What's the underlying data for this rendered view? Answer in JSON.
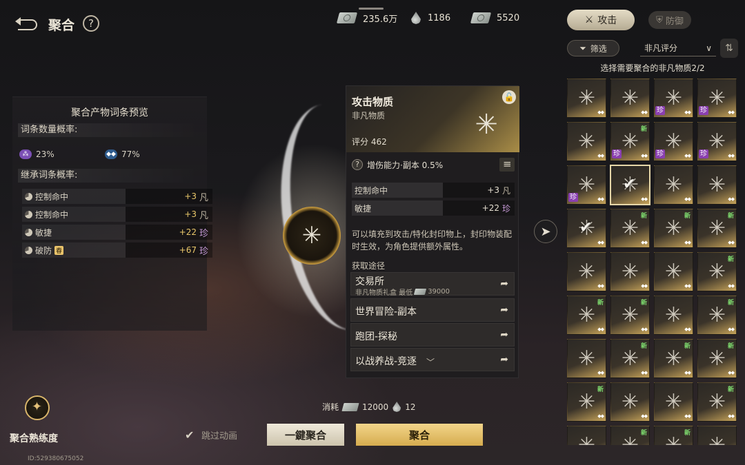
{
  "header": {
    "title": "聚合",
    "help_glyph": "?",
    "currencies": [
      {
        "icon": "cash-stack-icon",
        "value": "235.6万"
      },
      {
        "icon": "droplet-icon",
        "value": "1186"
      },
      {
        "icon": "cash-bundle-icon",
        "value": "5520"
      }
    ]
  },
  "preview": {
    "title": "聚合产物词条预览",
    "count_prob_label": "词条数量概率:",
    "count_probs": [
      {
        "value": "23%",
        "color": "#7b4fb5",
        "glyph": "⁂"
      },
      {
        "value": "77%",
        "color": "#2f5c8e",
        "glyph": "◆◆"
      }
    ],
    "inherit_label": "继承词条概率:",
    "affixes": [
      {
        "name": "控制命中",
        "value": "+3",
        "rank": "凡",
        "rank_type": "fan"
      },
      {
        "name": "控制命中",
        "value": "+3",
        "rank": "凡",
        "rank_type": "fan"
      },
      {
        "name": "敏捷",
        "value": "+22",
        "rank": "珍",
        "rank_type": "zhen"
      },
      {
        "name": "破防",
        "tag": "春",
        "value": "+67",
        "rank": "珍",
        "rank_type": "zhen"
      }
    ]
  },
  "card": {
    "name": "攻击物质",
    "type": "非凡物质",
    "score": "评分  462",
    "skill": "增伤能力·副本  0.5%",
    "stats": [
      {
        "name": "控制命中",
        "value": "+3",
        "rank": "凡"
      },
      {
        "name": "敏捷",
        "value": "+22",
        "rank": "珍"
      }
    ],
    "desc": "可以填充到攻击/特化封印物上，封印物装配时生效，为角色提供额外属性。",
    "source_label": "获取途径",
    "routes": [
      {
        "name": "交易所",
        "sub_prefix": "非凡物质礼盒 最低",
        "sub_value": "39000"
      },
      {
        "name": "世界冒险-副本"
      },
      {
        "name": "跑团-探秘"
      },
      {
        "name": "以战养战-竞逐"
      }
    ]
  },
  "right": {
    "tab_attack": "攻击",
    "tab_defense": "防御",
    "filter": "筛选",
    "sort": "非凡评分",
    "hint": "选择需要聚合的非凡物质2/2",
    "grid": [
      {
        "zhen": false,
        "new": false
      },
      {
        "zhen": false,
        "new": false
      },
      {
        "zhen": true,
        "new": false
      },
      {
        "zhen": true,
        "new": false
      },
      {
        "zhen": false,
        "new": false
      },
      {
        "zhen": true,
        "new": true
      },
      {
        "zhen": true,
        "new": false
      },
      {
        "zhen": true,
        "new": false
      },
      {
        "zhen": true,
        "new": false
      },
      {
        "zhen": false,
        "new": false,
        "selected": true,
        "check": true
      },
      {
        "zhen": false,
        "new": false
      },
      {
        "zhen": false,
        "new": false
      },
      {
        "zhen": false,
        "new": false,
        "check": true
      },
      {
        "zhen": false,
        "new": true
      },
      {
        "zhen": false,
        "new": true
      },
      {
        "zhen": false,
        "new": true
      },
      {
        "zhen": false,
        "new": false
      },
      {
        "zhen": false,
        "new": false
      },
      {
        "zhen": false,
        "new": false
      },
      {
        "zhen": false,
        "new": true
      },
      {
        "zhen": false,
        "new": true
      },
      {
        "zhen": false,
        "new": true
      },
      {
        "zhen": false,
        "new": false
      },
      {
        "zhen": false,
        "new": true
      },
      {
        "zhen": false,
        "new": false
      },
      {
        "zhen": false,
        "new": true
      },
      {
        "zhen": false,
        "new": true
      },
      {
        "zhen": false,
        "new": true
      },
      {
        "zhen": false,
        "new": true
      },
      {
        "zhen": false,
        "new": false
      },
      {
        "zhen": false,
        "new": false
      },
      {
        "zhen": false,
        "new": true
      },
      {
        "zhen": false,
        "new": false
      },
      {
        "zhen": false,
        "new": true
      },
      {
        "zhen": false,
        "new": true
      },
      {
        "zhen": false,
        "new": false
      }
    ],
    "zhen_label": "珍",
    "new_label": "新"
  },
  "bottom": {
    "proficiency": "聚合熟练度",
    "uid": "ID:529380675052",
    "skip": "跳过动画",
    "cost_label": "消耗",
    "cost_cash": "12000",
    "cost_drop": "12",
    "btn_one_click": "一鍵聚合",
    "btn_fuse": "聚合"
  }
}
